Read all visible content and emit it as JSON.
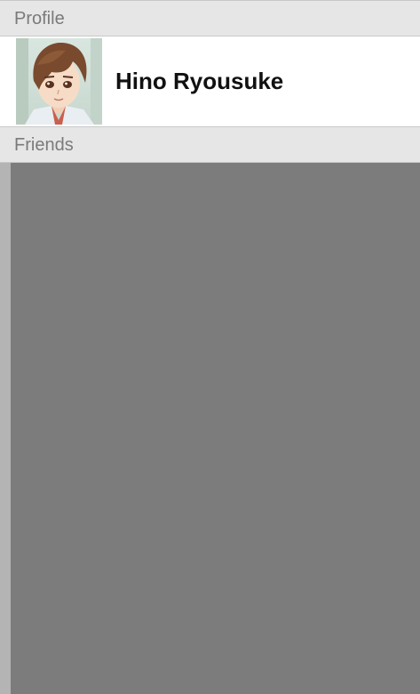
{
  "profile": {
    "section_label": "Profile",
    "name": "Hino Ryousuke",
    "avatar_icon": "anime-boy-avatar"
  },
  "friends": {
    "section_label": "Friends"
  },
  "colors": {
    "header_bg": "#e6e6e6",
    "header_text": "#7a7a7a",
    "friends_bg": "#7c7c7c",
    "scrollbar": "#b4b4b4"
  }
}
